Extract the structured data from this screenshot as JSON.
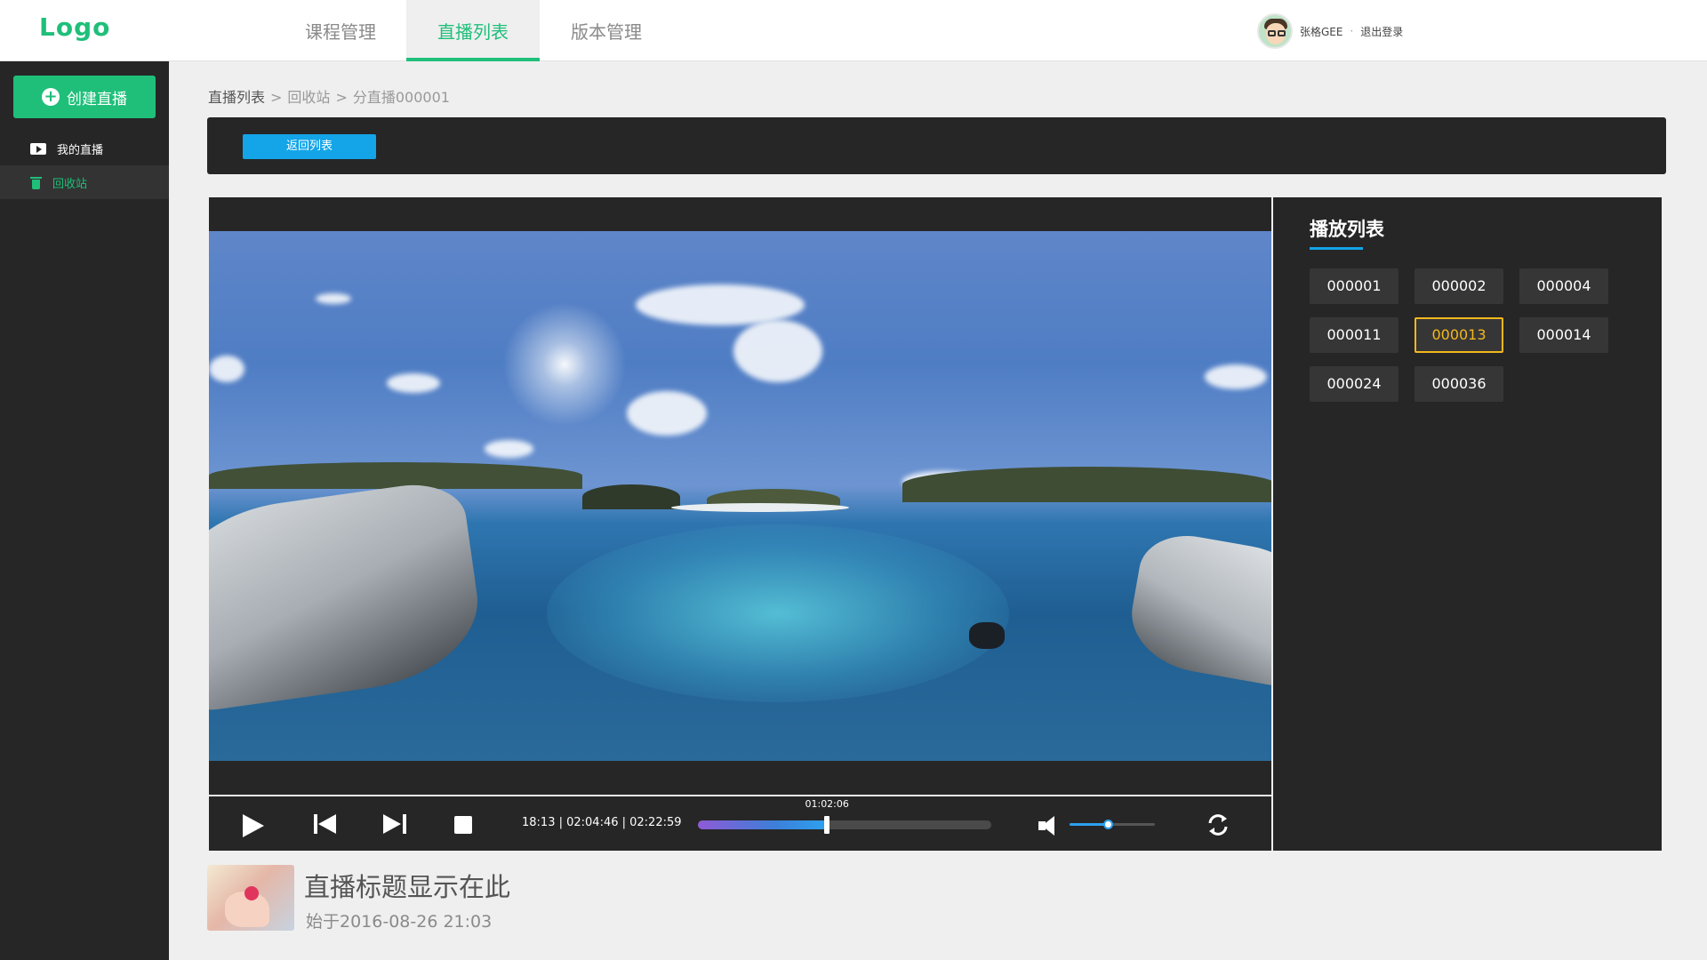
{
  "header": {
    "logo": "Logo",
    "tabs": [
      {
        "label": "课程管理",
        "active": false
      },
      {
        "label": "直播列表",
        "active": true
      },
      {
        "label": "版本管理",
        "active": false
      }
    ],
    "user": {
      "name": "张格GEE",
      "separator": "·",
      "logout": "退出登录"
    }
  },
  "sidebar": {
    "create_label": "创建直播",
    "items": [
      {
        "label": "我的直播",
        "icon": "video-icon",
        "active": false
      },
      {
        "label": "回收站",
        "icon": "trash-icon",
        "active": true
      }
    ]
  },
  "breadcrumb": {
    "items": [
      "直播列表",
      "回收站",
      "分直播000001"
    ],
    "separator": ">"
  },
  "toolbar": {
    "back_label": "返回列表"
  },
  "player": {
    "time_display": "18:13 | 02:04:46 | 02:22:59",
    "progress_tooltip": "01:02:06",
    "progress_fraction": 0.44,
    "volume_fraction": 0.45
  },
  "playlist": {
    "title": "播放列表",
    "items": [
      "000001",
      "000002",
      "000004",
      "000011",
      "000013",
      "000014",
      "000024",
      "000036"
    ],
    "selected": "000013"
  },
  "live_info": {
    "title": "直播标题显示在此",
    "start_text": "始于2016-08-26  21:03"
  },
  "colors": {
    "brand_green": "#1fbf7a",
    "accent_blue": "#13a5e8",
    "selected_yellow": "#f4b81e",
    "dark_panel": "#262626"
  }
}
